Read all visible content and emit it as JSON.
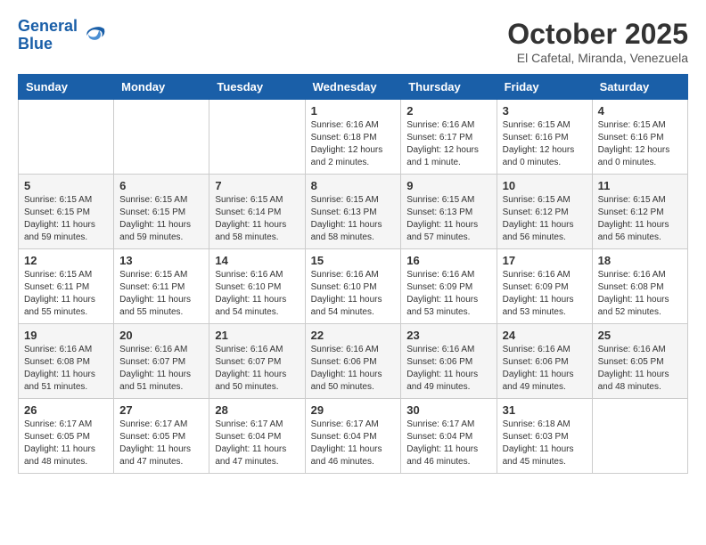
{
  "header": {
    "logo_line1": "General",
    "logo_line2": "Blue",
    "month_title": "October 2025",
    "subtitle": "El Cafetal, Miranda, Venezuela"
  },
  "days_of_week": [
    "Sunday",
    "Monday",
    "Tuesday",
    "Wednesday",
    "Thursday",
    "Friday",
    "Saturday"
  ],
  "weeks": [
    [
      {
        "day": "",
        "info": ""
      },
      {
        "day": "",
        "info": ""
      },
      {
        "day": "",
        "info": ""
      },
      {
        "day": "1",
        "info": "Sunrise: 6:16 AM\nSunset: 6:18 PM\nDaylight: 12 hours\nand 2 minutes."
      },
      {
        "day": "2",
        "info": "Sunrise: 6:16 AM\nSunset: 6:17 PM\nDaylight: 12 hours\nand 1 minute."
      },
      {
        "day": "3",
        "info": "Sunrise: 6:15 AM\nSunset: 6:16 PM\nDaylight: 12 hours\nand 0 minutes."
      },
      {
        "day": "4",
        "info": "Sunrise: 6:15 AM\nSunset: 6:16 PM\nDaylight: 12 hours\nand 0 minutes."
      }
    ],
    [
      {
        "day": "5",
        "info": "Sunrise: 6:15 AM\nSunset: 6:15 PM\nDaylight: 11 hours\nand 59 minutes."
      },
      {
        "day": "6",
        "info": "Sunrise: 6:15 AM\nSunset: 6:15 PM\nDaylight: 11 hours\nand 59 minutes."
      },
      {
        "day": "7",
        "info": "Sunrise: 6:15 AM\nSunset: 6:14 PM\nDaylight: 11 hours\nand 58 minutes."
      },
      {
        "day": "8",
        "info": "Sunrise: 6:15 AM\nSunset: 6:13 PM\nDaylight: 11 hours\nand 58 minutes."
      },
      {
        "day": "9",
        "info": "Sunrise: 6:15 AM\nSunset: 6:13 PM\nDaylight: 11 hours\nand 57 minutes."
      },
      {
        "day": "10",
        "info": "Sunrise: 6:15 AM\nSunset: 6:12 PM\nDaylight: 11 hours\nand 56 minutes."
      },
      {
        "day": "11",
        "info": "Sunrise: 6:15 AM\nSunset: 6:12 PM\nDaylight: 11 hours\nand 56 minutes."
      }
    ],
    [
      {
        "day": "12",
        "info": "Sunrise: 6:15 AM\nSunset: 6:11 PM\nDaylight: 11 hours\nand 55 minutes."
      },
      {
        "day": "13",
        "info": "Sunrise: 6:15 AM\nSunset: 6:11 PM\nDaylight: 11 hours\nand 55 minutes."
      },
      {
        "day": "14",
        "info": "Sunrise: 6:16 AM\nSunset: 6:10 PM\nDaylight: 11 hours\nand 54 minutes."
      },
      {
        "day": "15",
        "info": "Sunrise: 6:16 AM\nSunset: 6:10 PM\nDaylight: 11 hours\nand 54 minutes."
      },
      {
        "day": "16",
        "info": "Sunrise: 6:16 AM\nSunset: 6:09 PM\nDaylight: 11 hours\nand 53 minutes."
      },
      {
        "day": "17",
        "info": "Sunrise: 6:16 AM\nSunset: 6:09 PM\nDaylight: 11 hours\nand 53 minutes."
      },
      {
        "day": "18",
        "info": "Sunrise: 6:16 AM\nSunset: 6:08 PM\nDaylight: 11 hours\nand 52 minutes."
      }
    ],
    [
      {
        "day": "19",
        "info": "Sunrise: 6:16 AM\nSunset: 6:08 PM\nDaylight: 11 hours\nand 51 minutes."
      },
      {
        "day": "20",
        "info": "Sunrise: 6:16 AM\nSunset: 6:07 PM\nDaylight: 11 hours\nand 51 minutes."
      },
      {
        "day": "21",
        "info": "Sunrise: 6:16 AM\nSunset: 6:07 PM\nDaylight: 11 hours\nand 50 minutes."
      },
      {
        "day": "22",
        "info": "Sunrise: 6:16 AM\nSunset: 6:06 PM\nDaylight: 11 hours\nand 50 minutes."
      },
      {
        "day": "23",
        "info": "Sunrise: 6:16 AM\nSunset: 6:06 PM\nDaylight: 11 hours\nand 49 minutes."
      },
      {
        "day": "24",
        "info": "Sunrise: 6:16 AM\nSunset: 6:06 PM\nDaylight: 11 hours\nand 49 minutes."
      },
      {
        "day": "25",
        "info": "Sunrise: 6:16 AM\nSunset: 6:05 PM\nDaylight: 11 hours\nand 48 minutes."
      }
    ],
    [
      {
        "day": "26",
        "info": "Sunrise: 6:17 AM\nSunset: 6:05 PM\nDaylight: 11 hours\nand 48 minutes."
      },
      {
        "day": "27",
        "info": "Sunrise: 6:17 AM\nSunset: 6:05 PM\nDaylight: 11 hours\nand 47 minutes."
      },
      {
        "day": "28",
        "info": "Sunrise: 6:17 AM\nSunset: 6:04 PM\nDaylight: 11 hours\nand 47 minutes."
      },
      {
        "day": "29",
        "info": "Sunrise: 6:17 AM\nSunset: 6:04 PM\nDaylight: 11 hours\nand 46 minutes."
      },
      {
        "day": "30",
        "info": "Sunrise: 6:17 AM\nSunset: 6:04 PM\nDaylight: 11 hours\nand 46 minutes."
      },
      {
        "day": "31",
        "info": "Sunrise: 6:18 AM\nSunset: 6:03 PM\nDaylight: 11 hours\nand 45 minutes."
      },
      {
        "day": "",
        "info": ""
      }
    ]
  ]
}
